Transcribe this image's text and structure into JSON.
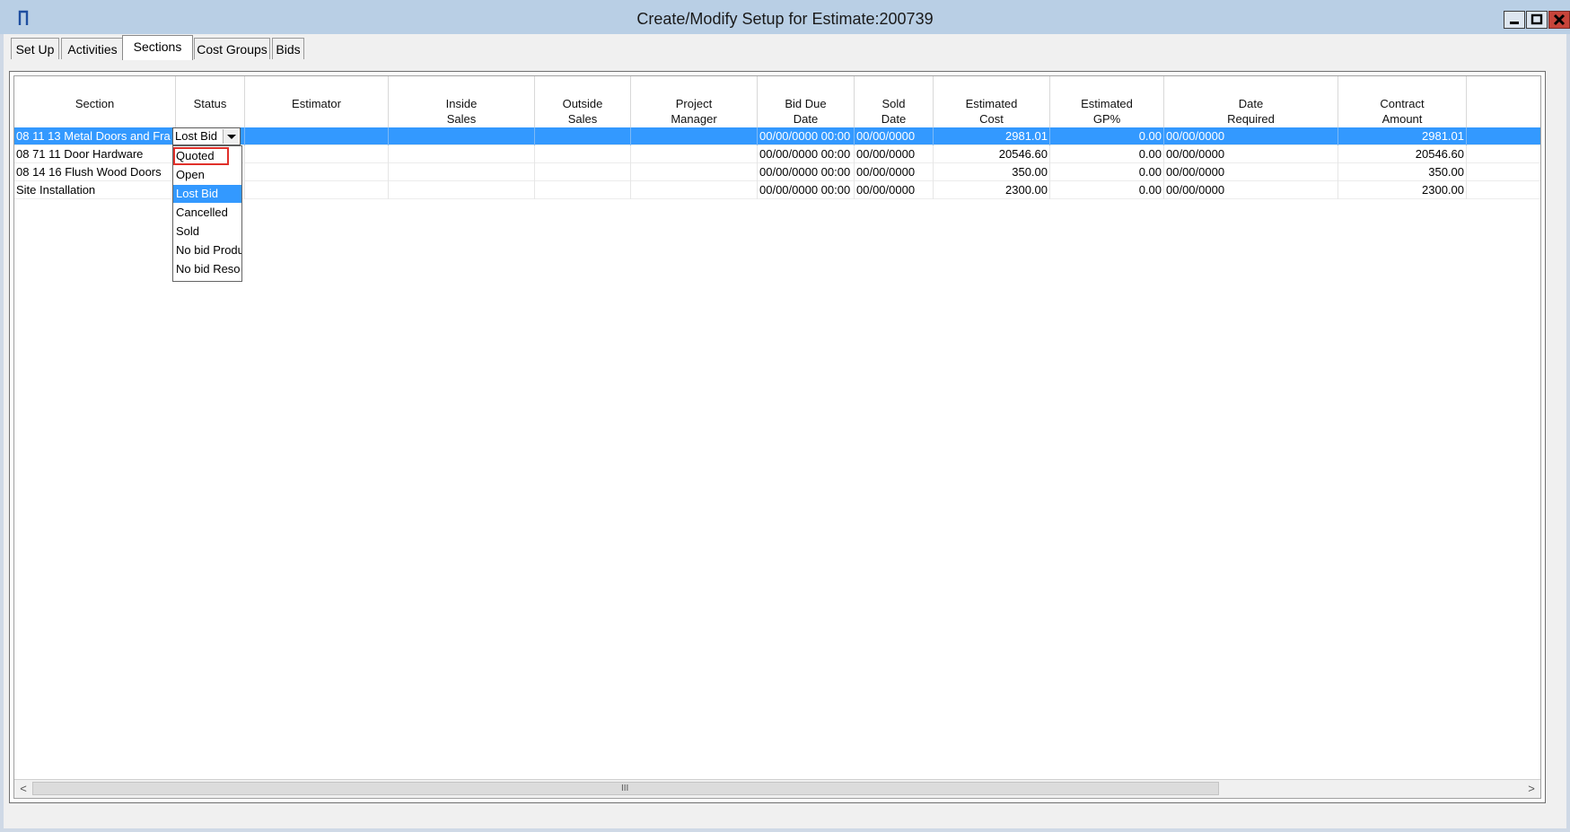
{
  "window": {
    "title": "Create/Modify Setup for Estimate:200739",
    "icon": "app-icon",
    "controls": [
      "minimize-icon",
      "maximize-icon",
      "close-icon"
    ]
  },
  "tabs": [
    {
      "label": "Set Up",
      "active": false
    },
    {
      "label": "Activities",
      "active": false
    },
    {
      "label": "Sections",
      "active": true
    },
    {
      "label": "Cost Groups",
      "active": false
    },
    {
      "label": "Bids",
      "active": false
    }
  ],
  "grid": {
    "columns": [
      {
        "line1": "Section",
        "line2": ""
      },
      {
        "line1": "Status",
        "line2": ""
      },
      {
        "line1": "Estimator",
        "line2": ""
      },
      {
        "line1": "Inside",
        "line2": "Sales"
      },
      {
        "line1": "Outside",
        "line2": "Sales"
      },
      {
        "line1": "Project",
        "line2": "Manager"
      },
      {
        "line1": "Bid Due",
        "line2": "Date"
      },
      {
        "line1": "Sold",
        "line2": "Date"
      },
      {
        "line1": "Estimated",
        "line2": "Cost"
      },
      {
        "line1": "Estimated",
        "line2": "GP%"
      },
      {
        "line1": "Date",
        "line2": "Required"
      },
      {
        "line1": "Contract",
        "line2": "Amount"
      }
    ],
    "rows": [
      {
        "section": "08 11 13 Metal Doors and Fra",
        "status": "Lost Bid",
        "estimator": "",
        "inside_sales": "",
        "outside_sales": "",
        "project_manager": "",
        "bid_due_date": "00/00/0000 00:00",
        "sold_date": "00/00/0000",
        "estimated_cost": "2981.01",
        "estimated_gp": "0.00",
        "date_required": "00/00/0000",
        "contract_amount": "2981.01",
        "selected": true
      },
      {
        "section": "08 71 11 Door Hardware",
        "status": "",
        "estimator": "",
        "inside_sales": "",
        "outside_sales": "",
        "project_manager": "",
        "bid_due_date": "00/00/0000 00:00",
        "sold_date": "00/00/0000",
        "estimated_cost": "20546.60",
        "estimated_gp": "0.00",
        "date_required": "00/00/0000",
        "contract_amount": "20546.60",
        "selected": false
      },
      {
        "section": "08 14 16 Flush Wood Doors",
        "status": "",
        "estimator": "",
        "inside_sales": "",
        "outside_sales": "",
        "project_manager": "",
        "bid_due_date": "00/00/0000 00:00",
        "sold_date": "00/00/0000",
        "estimated_cost": "350.00",
        "estimated_gp": "0.00",
        "date_required": "00/00/0000",
        "contract_amount": "350.00",
        "selected": false
      },
      {
        "section": "Site Installation",
        "status": "",
        "estimator": "",
        "inside_sales": "",
        "outside_sales": "",
        "project_manager": "",
        "bid_due_date": "00/00/0000 00:00",
        "sold_date": "00/00/0000",
        "estimated_cost": "2300.00",
        "estimated_gp": "0.00",
        "date_required": "00/00/0000",
        "contract_amount": "2300.00",
        "selected": false
      }
    ]
  },
  "status_dropdown": {
    "current_value": "Lost Bid",
    "options": [
      "Quoted",
      "Open",
      "Lost Bid",
      "Cancelled",
      "Sold",
      "No bid Produ",
      "No bid Reso"
    ],
    "highlighted": "Lost Bid",
    "marked": "Quoted"
  },
  "scrollbar": {
    "left_arrow": "<",
    "right_arrow": ">",
    "grip": "III"
  },
  "colors": {
    "selection": "#3399ff",
    "titlebar": "#b9cfe5",
    "close_button": "#c7443a",
    "marker": "#e0302a"
  }
}
